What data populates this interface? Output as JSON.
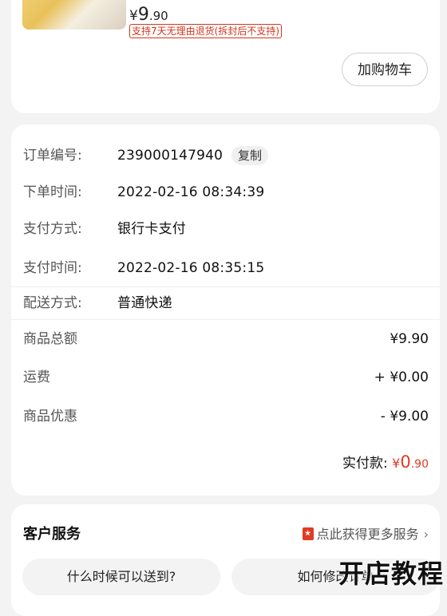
{
  "product": {
    "price_symbol": "¥",
    "price_int": "9",
    "price_dec": ".90",
    "return_policy": "支持7天无理由退货(拆封后不支持)",
    "cart_button": "加购物车"
  },
  "order": {
    "order_no_label": "订单编号:",
    "order_no": "239000147940",
    "copy_button": "复制",
    "order_time_label": "下单时间:",
    "order_time": "2022-02-16 08:34:39",
    "pay_method_label": "支付方式:",
    "pay_method": "银行卡支付",
    "pay_time_label": "支付时间:",
    "pay_time": "2022-02-16 08:35:15",
    "delivery_label": "配送方式:",
    "delivery": "普通快递",
    "subtotal_label": "商品总额",
    "subtotal": "¥9.90",
    "shipping_label": "运费",
    "shipping": "+ ¥0.00",
    "discount_label": "商品优惠",
    "discount": "- ¥9.00",
    "paid_label": "实付款:",
    "paid_symbol": "¥",
    "paid_int": "0",
    "paid_dec": ".90"
  },
  "service": {
    "title": "客户服务",
    "more": "点此获得更多服务",
    "q1": "什么时候可以送到?",
    "q2": "如何修改订单"
  },
  "watermark": "开店教程",
  "colors": {
    "accent": "#e03b24",
    "background": "#f3f3f3",
    "card": "#ffffff"
  },
  "icons": {
    "more": "chevron-right-icon",
    "badge": "star-badge-icon"
  }
}
